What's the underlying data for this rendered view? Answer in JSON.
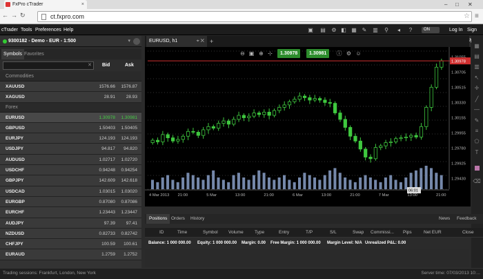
{
  "browser": {
    "tab_title": "FxPro cTrader",
    "url": "ct.fxpro.com"
  },
  "menu": {
    "items": [
      "cTrader",
      "Tools",
      "Preferences",
      "Help"
    ],
    "toggle": "ON",
    "login": "Log In",
    "signup": "Sign Up"
  },
  "account": {
    "label": "9300182 - Demo - EUR - 1:500"
  },
  "symbols_panel": {
    "tabs": [
      "Symbols",
      "Favorites"
    ],
    "col_bid": "Bid",
    "col_ask": "Ask",
    "groups": [
      {
        "name": "Commodities",
        "rows": [
          {
            "symbol": "XAUUSD",
            "bid": "1576.66",
            "ask": "1576.87"
          },
          {
            "symbol": "XAGUSD",
            "bid": "28.91",
            "ask": "28.93"
          }
        ]
      },
      {
        "name": "Forex",
        "rows": [
          {
            "symbol": "EURUSD",
            "bid": "1.30978",
            "ask": "1.30981",
            "selected": true
          },
          {
            "symbol": "GBPUSD",
            "bid": "1.50403",
            "ask": "1.50405"
          },
          {
            "symbol": "EURJPY",
            "bid": "124.193",
            "ask": "124.193"
          },
          {
            "symbol": "USDJPY",
            "bid": "94.817",
            "ask": "94.820"
          },
          {
            "symbol": "AUDUSD",
            "bid": "1.02717",
            "ask": "1.02720"
          },
          {
            "symbol": "USDCHF",
            "bid": "0.94248",
            "ask": "0.94254"
          },
          {
            "symbol": "GBPJPY",
            "bid": "142.609",
            "ask": "142.618"
          },
          {
            "symbol": "USDCAD",
            "bid": "1.03015",
            "ask": "1.03020"
          },
          {
            "symbol": "EURGBP",
            "bid": "0.87080",
            "ask": "0.87086"
          },
          {
            "symbol": "EURCHF",
            "bid": "1.23443",
            "ask": "1.23447"
          },
          {
            "symbol": "AUDJPY",
            "bid": "97.39",
            "ask": "97.41"
          },
          {
            "symbol": "NZDUSD",
            "bid": "0.82733",
            "ask": "0.82742"
          },
          {
            "symbol": "CHFJPY",
            "bid": "100.59",
            "ask": "100.61"
          },
          {
            "symbol": "EURAUD",
            "bid": "1.2759",
            "ask": "1.2752"
          }
        ]
      }
    ]
  },
  "chart_tab": {
    "title": "EURUSD, h1"
  },
  "chart_toolbar": {
    "sell_price": "1.30978",
    "buy_price": "1.30981"
  },
  "chart_data": {
    "type": "candlestick",
    "symbol": "EURUSD",
    "timeframe": "h1",
    "current_price": "1.30978",
    "crosshair_time": "06:01",
    "y_ticks": [
      "1.31055",
      "1.30978",
      "1.30705",
      "1.30515",
      "1.30330",
      "1.30155",
      "1.29955",
      "1.29780",
      "1.29925",
      "1.29430"
    ],
    "x_ticks": [
      "4 Mar 2013",
      "21:00",
      "5 Mar",
      "13:00",
      "21:00",
      "6 Mar",
      "13:00",
      "21:00",
      "7 Mar",
      "13:00",
      "21:00"
    ],
    "closes": [
      1.2999,
      1.2997,
      1.3006,
      1.3002,
      1.2998,
      1.3,
      1.3004,
      1.301,
      1.3009,
      1.3005,
      1.3012,
      1.3016,
      1.3014,
      1.302,
      1.3023,
      1.3019,
      1.3025,
      1.303,
      1.3027,
      1.3029,
      1.3033,
      1.3031,
      1.3034,
      1.303,
      1.3036,
      1.304,
      1.3043,
      1.3047,
      1.305,
      1.3054,
      1.3052,
      1.3049,
      1.3051,
      1.3049,
      1.3046,
      1.3045,
      1.3033,
      1.3025,
      1.3015,
      1.3004,
      1.2998,
      1.2988,
      1.2978,
      1.2976,
      1.299,
      1.2992,
      1.2996,
      1.2997,
      1.3001,
      1.3002,
      1.3003,
      1.3005,
      1.3003,
      1.3016,
      1.304,
      1.3065,
      1.309,
      1.3098
    ],
    "volume_relative": [
      0.4,
      0.3,
      0.5,
      0.6,
      0.4,
      0.3,
      0.5,
      0.7,
      0.6,
      0.5,
      0.4,
      0.6,
      0.8,
      0.5,
      0.4,
      0.3,
      0.6,
      0.7,
      0.5,
      0.4,
      0.6,
      0.8,
      0.7,
      0.5,
      0.4,
      0.5,
      0.6,
      0.4,
      0.3,
      0.5,
      0.7,
      0.6,
      0.5,
      0.4,
      0.6,
      0.8,
      0.9,
      0.7,
      0.5,
      0.4,
      0.3,
      0.5,
      0.6,
      0.5,
      0.4,
      0.3,
      0.5,
      0.6,
      0.4,
      0.3,
      0.5,
      0.7,
      0.8,
      0.9,
      1.0,
      0.9,
      0.7,
      0.6
    ]
  },
  "bottom_tabs": {
    "items": [
      "Positions",
      "Orders",
      "History"
    ],
    "right_items": [
      "News",
      "Feedback"
    ]
  },
  "positions_table": {
    "columns": [
      "ID",
      "Time",
      "Symbol",
      "Volume",
      "Type",
      "Entry",
      "T/P",
      "S/L",
      "Swap",
      "Commissi...",
      "Pips",
      "Net EUR",
      "Close"
    ]
  },
  "balance_row": {
    "balance": "Balance: 1 000 000.00",
    "equity": "Equity: 1 000 000.00",
    "margin": "Margin: 0.00",
    "free_margin": "Free Margin: 1 000 000.00",
    "margin_level": "Margin Level: N/A",
    "unrealized": "Unrealized P&L: 0.00"
  },
  "status_bar": {
    "sessions": "Trading sessions: Frankfurt, London, New York",
    "server_time": "Server time: 07/03/2013 10:..."
  },
  "colors": {
    "bull": "#3fc83f",
    "bear": "#3fc83f",
    "price_line": "#d03030",
    "volume": "#8aa0c8",
    "buy_green": "#2d8d2d"
  }
}
